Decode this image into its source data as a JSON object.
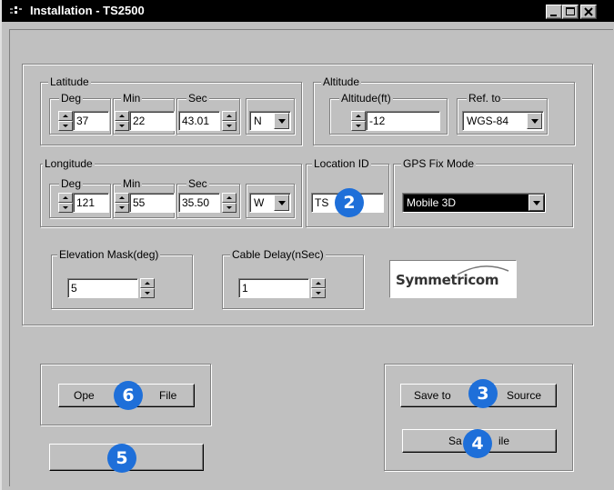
{
  "window": {
    "title": "Installation - TS2500",
    "minimize_icon": "minimize-icon",
    "maximize_icon": "maximize-icon",
    "close_icon": "close-icon"
  },
  "latitude": {
    "legend": "Latitude",
    "deg_label": "Deg",
    "deg_value": "37",
    "min_label": "Min",
    "min_value": "22",
    "sec_label": "Sec",
    "sec_value": "43.01",
    "hemisphere": "N"
  },
  "altitude": {
    "legend": "Altitude",
    "alt_label": "Altitude(ft)",
    "alt_value": "-12",
    "ref_label": "Ref. to",
    "ref_value": "WGS-84"
  },
  "longitude": {
    "legend": "Longitude",
    "deg_label": "Deg",
    "deg_value": "121",
    "min_label": "Min",
    "min_value": "55",
    "sec_label": "Sec",
    "sec_value": "35.50",
    "hemisphere": "W"
  },
  "location_id": {
    "legend": "Location ID",
    "value": "TS"
  },
  "gps_fix_mode": {
    "legend": "GPS Fix Mode",
    "value": "Mobile 3D"
  },
  "elevation_mask": {
    "legend": "Elevation Mask(deg)",
    "value": "5"
  },
  "cable_delay": {
    "legend": "Cable Delay(nSec)",
    "value": "1"
  },
  "logo": {
    "text": "Symmetricom"
  },
  "buttons": {
    "open_file": "Ope",
    "open_file_tail": "File",
    "save_to_source_head": "Save to",
    "save_to_source_tail": "Source",
    "save_file_head": "Sa",
    "save_file_tail": "ile",
    "blank": ""
  },
  "badges": {
    "b2": "2",
    "b3": "3",
    "b4": "4",
    "b5": "5",
    "b6": "6"
  },
  "colors": {
    "badge": "#1e6fd9",
    "titlebar": "#000000",
    "face": "#c0c0c0"
  }
}
